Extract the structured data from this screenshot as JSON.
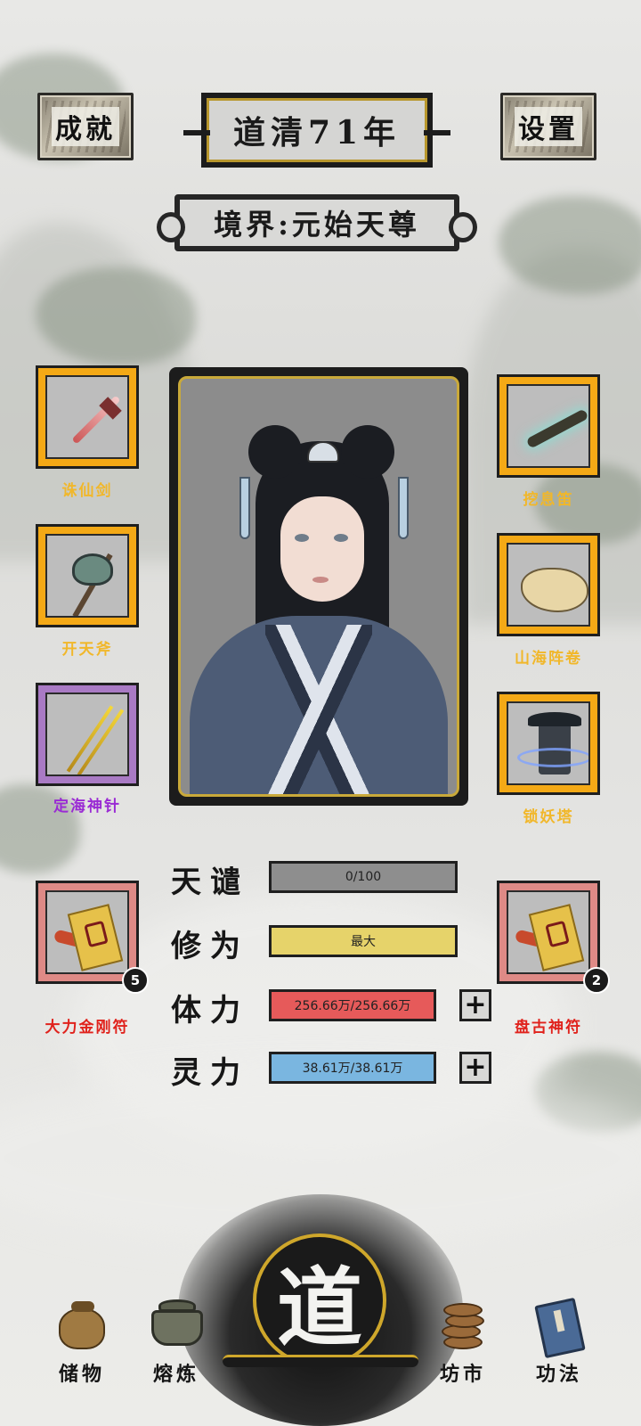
{
  "header": {
    "achievements_label": "成就",
    "year_label": "道清71年",
    "settings_label": "设置",
    "realm_label": "境界:元始天尊"
  },
  "equipment": {
    "left": [
      {
        "name": "诛仙剑",
        "rarity_color": "#f4a916",
        "label_color": "#f1b72a",
        "icon": "sword-icon"
      },
      {
        "name": "开天斧",
        "rarity_color": "#f4a916",
        "label_color": "#f1b72a",
        "icon": "axe-icon"
      },
      {
        "name": "定海神针",
        "rarity_color": "#a97ac4",
        "label_color": "#9a2ad4",
        "icon": "needle-icon"
      }
    ],
    "right": [
      {
        "name": "挖息笛",
        "rarity_color": "#f4a916",
        "label_color": "#f1b72a",
        "icon": "flute-icon"
      },
      {
        "name": "山海阵卷",
        "rarity_color": "#f4a916",
        "label_color": "#f1b72a",
        "icon": "scroll-map-icon"
      },
      {
        "name": "锁妖塔",
        "rarity_color": "#f4a916",
        "label_color": "#f1b72a",
        "icon": "pagoda-icon"
      }
    ]
  },
  "talismans": [
    {
      "name": "大力金刚符",
      "count": "5",
      "label_color": "#e0221c",
      "icon": "talisman-icon"
    },
    {
      "name": "盘古神符",
      "count": "2",
      "label_color": "#e0221c",
      "icon": "talisman-icon"
    }
  ],
  "stats": {
    "tianqian": {
      "label": "天谴",
      "value_text": "0/100",
      "fraction": 0,
      "color": "#8e8e8e"
    },
    "xiuwei": {
      "label": "修为",
      "value_text": "最大",
      "fraction": 1,
      "color": "#e6d36a"
    },
    "tili": {
      "label": "体力",
      "value_text": "256.66万/256.66万",
      "fraction": 1,
      "color": "#e65a5a"
    },
    "lingli": {
      "label": "灵力",
      "value_text": "38.61万/38.61万",
      "fraction": 1,
      "color": "#7ab6e0"
    }
  },
  "nav": {
    "storage": "储物",
    "smelt": "熔炼",
    "dao": "道",
    "market": "坊市",
    "skills": "功法"
  },
  "colors": {
    "gold_frame": "#cfa72b",
    "ink": "#1a1a1a"
  }
}
